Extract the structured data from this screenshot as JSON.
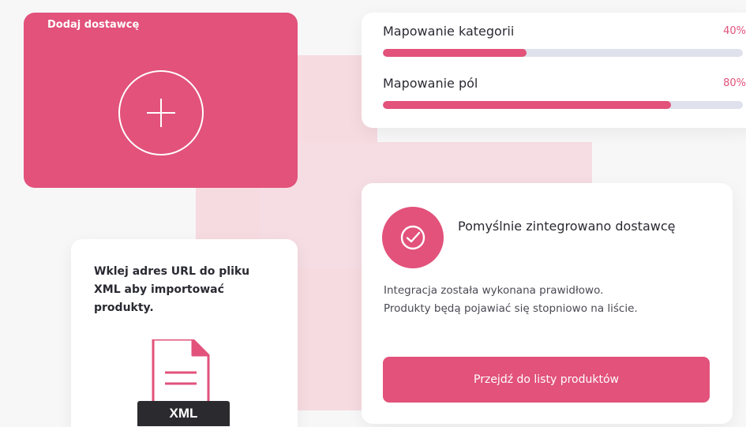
{
  "add_supplier": {
    "title": "Dodaj dostawcę",
    "plus_icon": "plus-icon"
  },
  "progress": {
    "items": [
      {
        "label": "Mapowanie kategorii",
        "percent_text": "40%",
        "value": 0.4
      },
      {
        "label": "Mapowanie pól",
        "percent_text": "80%",
        "value": 0.8
      }
    ]
  },
  "xml_import": {
    "instruction": "Wklej adres URL do pliku XML aby importować produkty.",
    "file_label": "XML",
    "icon": "xml-file-icon"
  },
  "success": {
    "icon": "check-circle-icon",
    "title": "Pomyślnie zintegrowano dostawcę",
    "line1": "Integracja została wykonana prawidłowo.",
    "line2": "Produkty będą pojawiać się stopniowo na liście.",
    "button_label": "Przejdź do listy produktów"
  },
  "colors": {
    "accent": "#e2527b",
    "track": "#dfe1ec",
    "background_blob": "#f6dbe1"
  }
}
